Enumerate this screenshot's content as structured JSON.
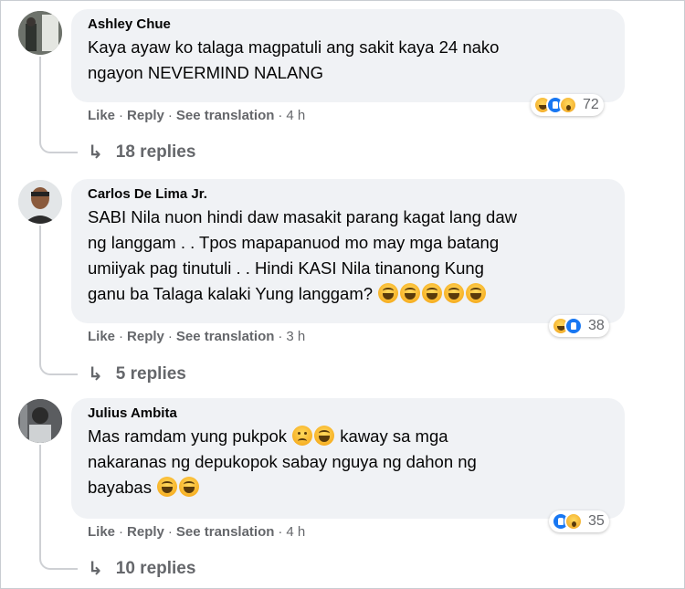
{
  "comments": [
    {
      "author": "Ashley Chue",
      "text": "Kaya ayaw ko talaga magpatuli ang sakit kaya 24 nako\nngayon NEVERMIND NALANG",
      "reactions": [
        "haha",
        "like",
        "wow"
      ],
      "reaction_count": "72",
      "actions": {
        "like": "Like",
        "reply": "Reply",
        "translate": "See translation",
        "time": "4 h"
      },
      "replies": "18 replies"
    },
    {
      "author": "Carlos De Lima Jr.",
      "text_lines": [
        "SABI Nila nuon hindi daw masakit parang kagat lang daw",
        "ng langgam . . Tpos mapapanuod mo may mga batang",
        "umiiyak pag tinutuli . . Hindi KASI Nila tinanong Kung",
        "ganu ba Talaga kalaki Yung langgam?"
      ],
      "reactions": [
        "haha",
        "like"
      ],
      "reaction_count": "38",
      "actions": {
        "like": "Like",
        "reply": "Reply",
        "translate": "See translation",
        "time": "3 h"
      },
      "replies": "5 replies"
    },
    {
      "author": "Julius Ambita",
      "text_parts": {
        "line1": "Mas ramdam yung pukpok",
        "line1b": "kaway sa mga",
        "line2": "nakaranas ng depukopok sabay nguya ng dahon ng",
        "line3": "bayabas"
      },
      "reactions": [
        "like",
        "wow"
      ],
      "reaction_count": "35",
      "actions": {
        "like": "Like",
        "reply": "Reply",
        "translate": "See translation",
        "time": "4 h"
      },
      "replies": "10 replies"
    }
  ],
  "icons": {
    "reply_arrow": "↳",
    "emoji": "laughing-face-emoji",
    "sad_emoji": "sad-face-emoji"
  },
  "colors": {
    "bubble": "#f0f2f5",
    "secondary_text": "#65676b",
    "like_blue": "#1877f2"
  }
}
